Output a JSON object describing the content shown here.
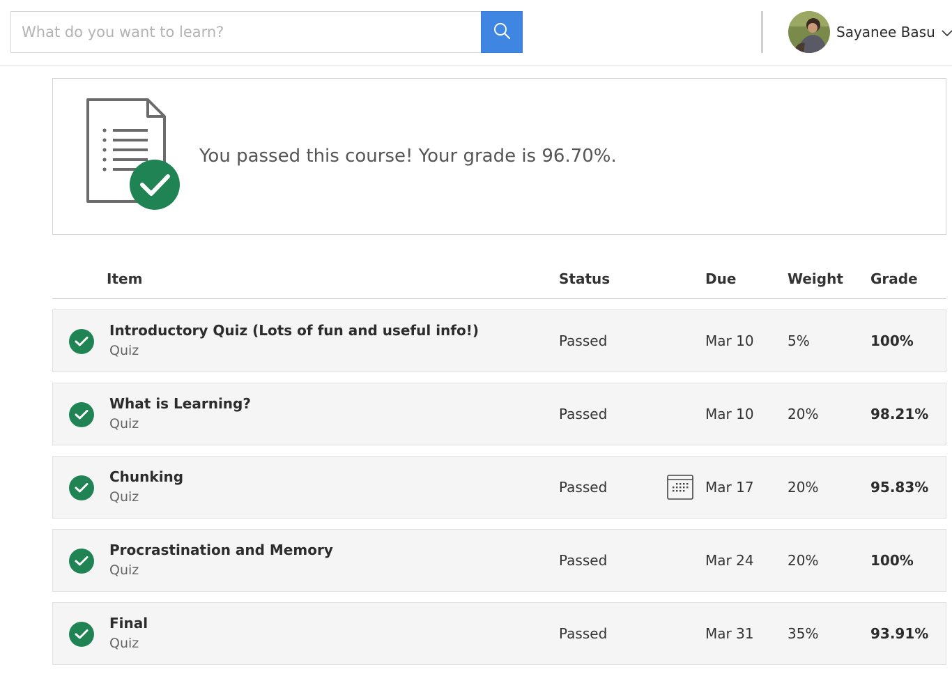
{
  "header": {
    "search": {
      "placeholder": "What do you want to learn?",
      "value": ""
    },
    "user": {
      "name": "Sayanee Basu"
    }
  },
  "banner": {
    "message": "You passed this course! Your grade is 96.70%."
  },
  "table": {
    "columns": {
      "item": "Item",
      "status": "Status",
      "due": "Due",
      "weight": "Weight",
      "grade": "Grade"
    },
    "rows": [
      {
        "title": "Introductory Quiz (Lots of fun and useful info!)",
        "type": "Quiz",
        "status": "Passed",
        "due": "Mar 10",
        "weight": "5%",
        "grade": "100%",
        "calendar_icon": false
      },
      {
        "title": "What is Learning?",
        "type": "Quiz",
        "status": "Passed",
        "due": "Mar 10",
        "weight": "20%",
        "grade": "98.21%",
        "calendar_icon": false
      },
      {
        "title": "Chunking",
        "type": "Quiz",
        "status": "Passed",
        "due": "Mar 17",
        "weight": "20%",
        "grade": "95.83%",
        "calendar_icon": true
      },
      {
        "title": "Procrastination and Memory",
        "type": "Quiz",
        "status": "Passed",
        "due": "Mar 24",
        "weight": "20%",
        "grade": "100%",
        "calendar_icon": false
      },
      {
        "title": "Final",
        "type": "Quiz",
        "status": "Passed",
        "due": "Mar 31",
        "weight": "35%",
        "grade": "93.91%",
        "calendar_icon": false
      }
    ]
  },
  "colors": {
    "accent_blue": "#3f86e3",
    "success_green": "#1f8354",
    "row_background": "#f5f5f5"
  },
  "icons": {
    "search": "search-icon",
    "user_menu": "chevron-down-icon",
    "banner": "document-check-icon",
    "row_status": "check-circle-icon",
    "due_calendar": "calendar-icon"
  }
}
